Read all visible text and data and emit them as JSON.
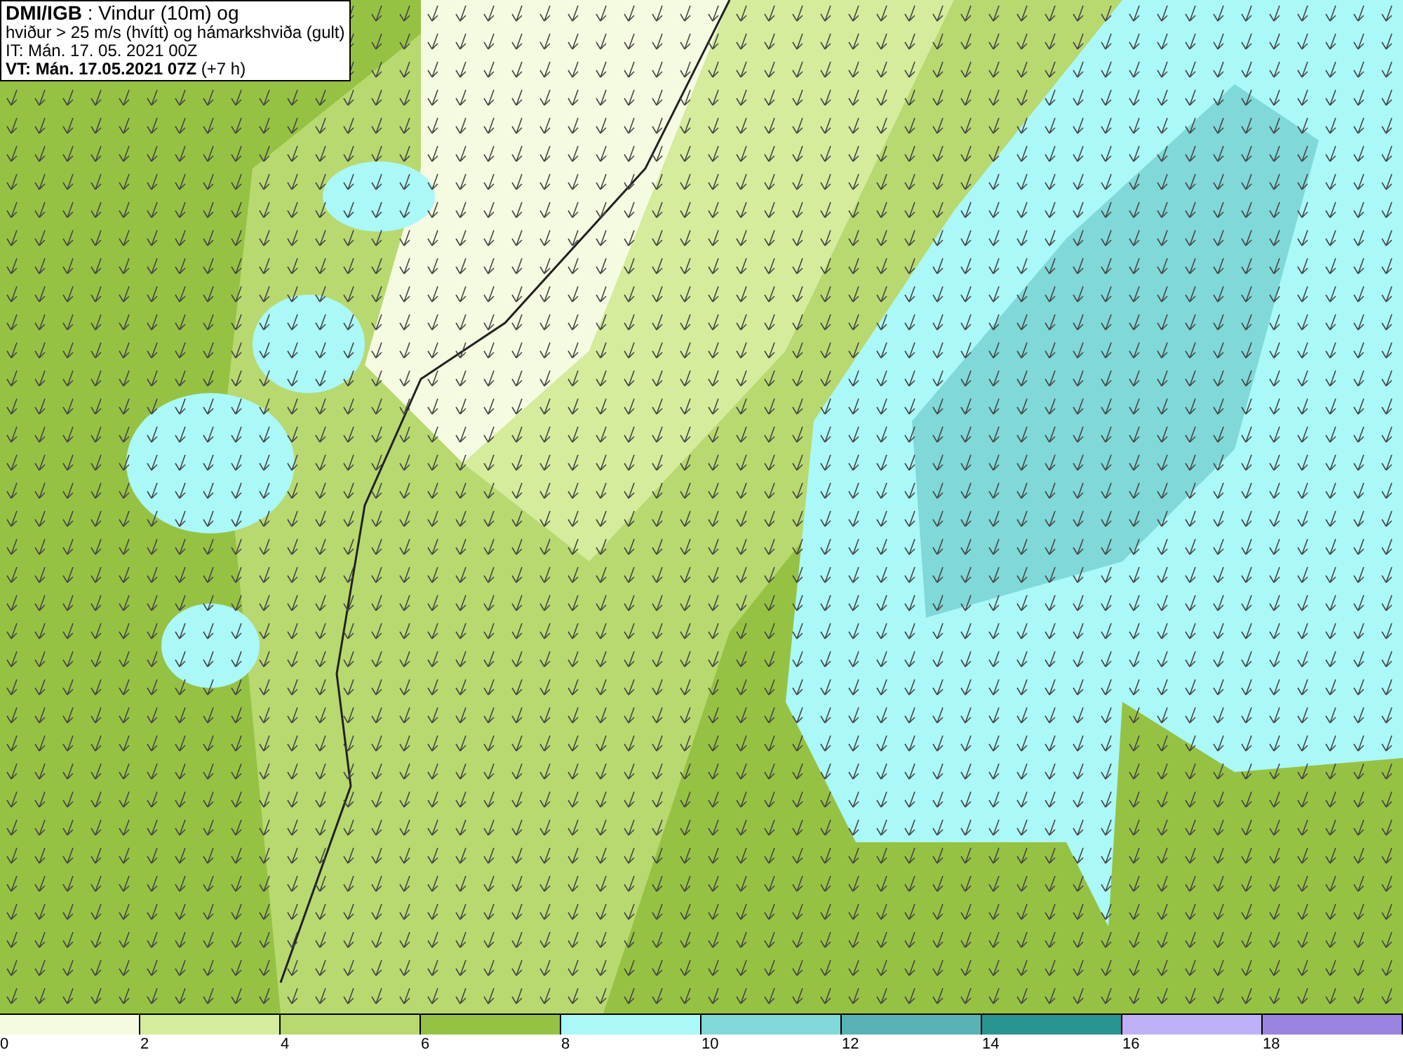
{
  "header": {
    "lines": [
      "**DMI/IGB** : Vindur (10m) og",
      "hviður > 25 m/s (hvítt) og hámarkshviða (gult)",
      "IT: Mán. 17. 05. 2021 00Z",
      "**VT: Mán. 17.05.2021 07Z** (+7 h)"
    ]
  },
  "legend": {
    "bins": [
      {
        "label": "0",
        "color": "#f5fbe0"
      },
      {
        "label": "2",
        "color": "#d4ec9c"
      },
      {
        "label": "4",
        "color": "#b8d970"
      },
      {
        "label": "6",
        "color": "#96c244"
      },
      {
        "label": "8",
        "color": "#aaf8f8"
      },
      {
        "label": "10",
        "color": "#80d8d8"
      },
      {
        "label": "12",
        "color": "#58b4b4"
      },
      {
        "label": "14",
        "color": "#2a9490"
      },
      {
        "label": "16",
        "color": "#c0b0f8"
      },
      {
        "label": "18",
        "color": "#9a84e0"
      }
    ]
  }
}
